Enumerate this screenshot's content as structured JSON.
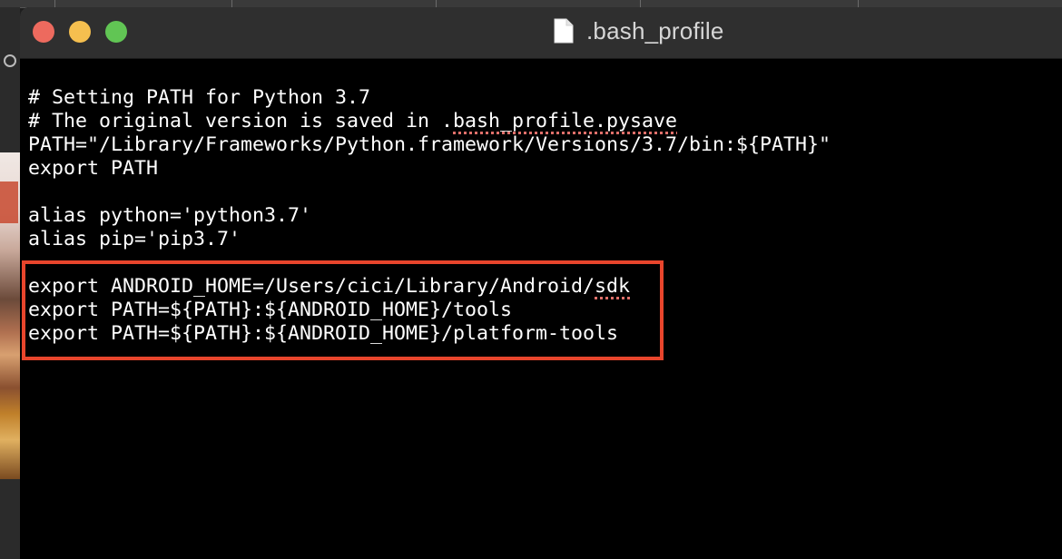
{
  "window": {
    "title": ".bash_profile",
    "file_icon": "document-icon"
  },
  "traffic_lights": {
    "close": "#ed6a5e",
    "minimize": "#f5bf4f",
    "zoom": "#61c554"
  },
  "editor": {
    "lines": [
      {
        "segments": [
          {
            "text": "# Setting PATH for Python 3.7"
          }
        ]
      },
      {
        "segments": [
          {
            "text": "# The original version is saved in ."
          },
          {
            "text": "bash_profile.pysave",
            "spell": true
          }
        ]
      },
      {
        "segments": [
          {
            "text": "PATH=\"/Library/Frameworks/Python.framework/Versions/3.7/bin:${PATH}\""
          }
        ]
      },
      {
        "segments": [
          {
            "text": "export PATH"
          }
        ]
      },
      {
        "segments": [
          {
            "text": ""
          }
        ]
      },
      {
        "segments": [
          {
            "text": "alias python='python3.7'"
          }
        ]
      },
      {
        "segments": [
          {
            "text": "alias pip='pip3.7'"
          }
        ]
      },
      {
        "segments": [
          {
            "text": ""
          }
        ]
      },
      {
        "segments": [
          {
            "text": "export ANDROID_HOME=/Users/cici/Library/Android/"
          },
          {
            "text": "sdk",
            "spell": true
          }
        ]
      },
      {
        "segments": [
          {
            "text": "export PATH=${PATH}:${ANDROID_HOME}/tools"
          }
        ]
      },
      {
        "segments": [
          {
            "text": "export PATH=${PATH}:${ANDROID_HOME}/platform-tools"
          }
        ]
      }
    ]
  },
  "highlight": {
    "color": "#e8452c",
    "covers": "android-exports"
  }
}
